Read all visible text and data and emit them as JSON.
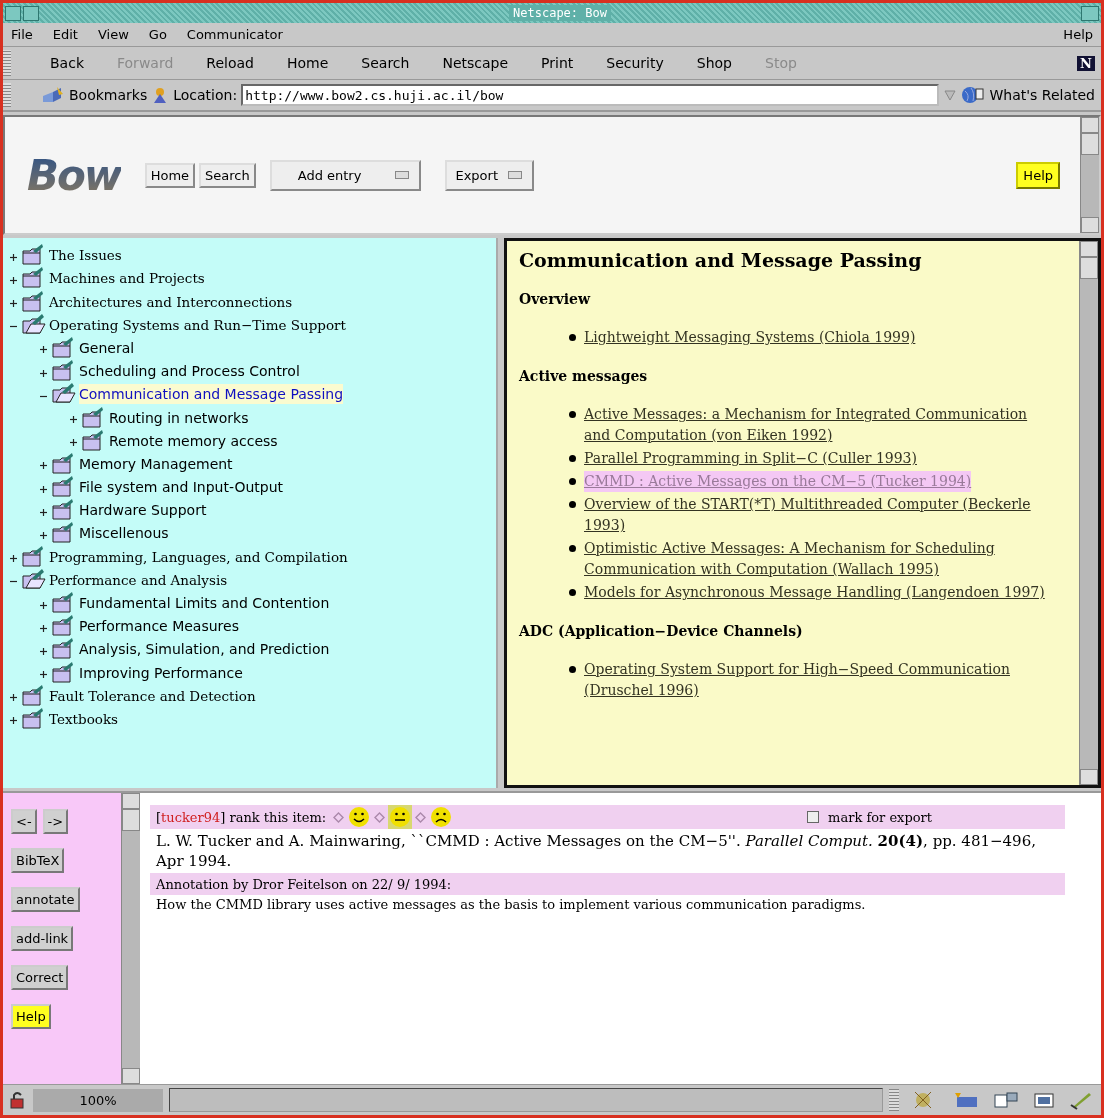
{
  "window": {
    "title": "Netscape: Bow"
  },
  "menu": [
    "File",
    "Edit",
    "View",
    "Go",
    "Communicator"
  ],
  "menu_right": "Help",
  "toolbar": [
    {
      "label": "Back",
      "disabled": false
    },
    {
      "label": "Forward",
      "disabled": true
    },
    {
      "label": "Reload",
      "disabled": false
    },
    {
      "label": "Home",
      "disabled": false
    },
    {
      "label": "Search",
      "disabled": false
    },
    {
      "label": "Netscape",
      "disabled": false
    },
    {
      "label": "Print",
      "disabled": false
    },
    {
      "label": "Security",
      "disabled": false
    },
    {
      "label": "Shop",
      "disabled": false
    },
    {
      "label": "Stop",
      "disabled": true
    }
  ],
  "toolbar_logo": "N",
  "location_bar": {
    "bookmarks": "Bookmarks",
    "location_label": "Location:",
    "url": "http://www.bow2.cs.huji.ac.il/bow",
    "related": "What's Related"
  },
  "bow_bar": {
    "logo": "Bow",
    "buttons": [
      "Home",
      "Search"
    ],
    "dropdowns": [
      "Add entry",
      "Export"
    ],
    "help": "Help"
  },
  "tree": [
    {
      "label": "The Issues",
      "expanded": false,
      "selected": false
    },
    {
      "label": "Machines and Projects",
      "expanded": false,
      "selected": false
    },
    {
      "label": "Architectures and Interconnections",
      "expanded": false,
      "selected": false
    },
    {
      "label": "Operating Systems and Run−Time Support",
      "expanded": true,
      "selected": false,
      "children": [
        {
          "label": "General",
          "expanded": false,
          "selected": false
        },
        {
          "label": "Scheduling and Process Control",
          "expanded": false,
          "selected": false
        },
        {
          "label": "Communication and Message Passing",
          "expanded": true,
          "selected": true,
          "children": [
            {
              "label": "Routing in networks",
              "expanded": false,
              "selected": false
            },
            {
              "label": "Remote memory access",
              "expanded": false,
              "selected": false
            }
          ]
        },
        {
          "label": "Memory Management",
          "expanded": false,
          "selected": false
        },
        {
          "label": "File system and Input-Output",
          "expanded": false,
          "selected": false
        },
        {
          "label": "Hardware Support",
          "expanded": false,
          "selected": false
        },
        {
          "label": "Miscellenous",
          "expanded": false,
          "selected": false
        }
      ]
    },
    {
      "label": "Programming, Languages, and Compilation",
      "expanded": false,
      "selected": false
    },
    {
      "label": "Performance and Analysis",
      "expanded": true,
      "selected": false,
      "children": [
        {
          "label": "Fundamental Limits and Contention",
          "expanded": false,
          "selected": false
        },
        {
          "label": "Performance Measures",
          "expanded": false,
          "selected": false
        },
        {
          "label": "Analysis, Simulation, and Prediction",
          "expanded": false,
          "selected": false
        },
        {
          "label": "Improving Performance",
          "expanded": false,
          "selected": false
        }
      ]
    },
    {
      "label": "Fault Tolerance and Detection",
      "expanded": false,
      "selected": false
    },
    {
      "label": "Textbooks",
      "expanded": false,
      "selected": false
    }
  ],
  "content": {
    "title": "Communication and Message Passing",
    "sections": [
      {
        "heading": "Overview",
        "links": [
          {
            "text": "Lightweight Messaging Systems (Chiola 1999)",
            "selected": false
          }
        ]
      },
      {
        "heading": "Active messages",
        "links": [
          {
            "text": "Active Messages: a Mechanism for Integrated Communication and Computation (von Eiken 1992)",
            "selected": false
          },
          {
            "text": "Parallel Programming in Split−C (Culler 1993)",
            "selected": false
          },
          {
            "text": "CMMD : Active Messages on the CM−5 (Tucker 1994)",
            "selected": true
          },
          {
            "text": "Overview of the START(*T) Multithreaded Computer (Beckerle 1993)",
            "selected": false
          },
          {
            "text": "Optimistic Active Messages: A Mechanism for Scheduling Communication with Computation (Wallach 1995)",
            "selected": false
          },
          {
            "text": "Models for Asynchronous Message Handling (Langendoen 1997)",
            "selected": false
          }
        ]
      },
      {
        "heading": "ADC (Application−Device Channels)",
        "links": [
          {
            "text": "Operating System Support for High−Speed Communication (Druschel 1996)",
            "selected": false
          }
        ]
      }
    ]
  },
  "side_buttons": [
    {
      "label": "<-",
      "kind": "nav"
    },
    {
      "label": "->",
      "kind": "nav"
    },
    {
      "label": "BibTeX",
      "kind": "plain"
    },
    {
      "label": "annotate",
      "kind": "plain"
    },
    {
      "label": "add-link",
      "kind": "plain"
    },
    {
      "label": "Correct",
      "kind": "plain"
    },
    {
      "label": "Help",
      "kind": "help"
    }
  ],
  "entry": {
    "key_open": "[",
    "key": "tucker94",
    "rank_label": "] rank this item:",
    "ranks": [
      {
        "kind": "happy",
        "selected": false
      },
      {
        "kind": "neutral",
        "selected": true
      },
      {
        "kind": "sad",
        "selected": false
      }
    ],
    "export_label": "mark for export",
    "export_checked": false,
    "citation": "L. W. Tucker and A. Mainwaring, ``CMMD : Active Messages on the CM−5''. *Parallel Comput.* **20(4)**, pp. 481−496, Apr 1994.",
    "annotation_header": "Annotation by Dror Feitelson on 22/ 9/ 1994:",
    "annotation": "How the CMMD library uses active messages as the basis to implement various communication paradigms."
  },
  "status_bar": {
    "zoom": "100%"
  }
}
